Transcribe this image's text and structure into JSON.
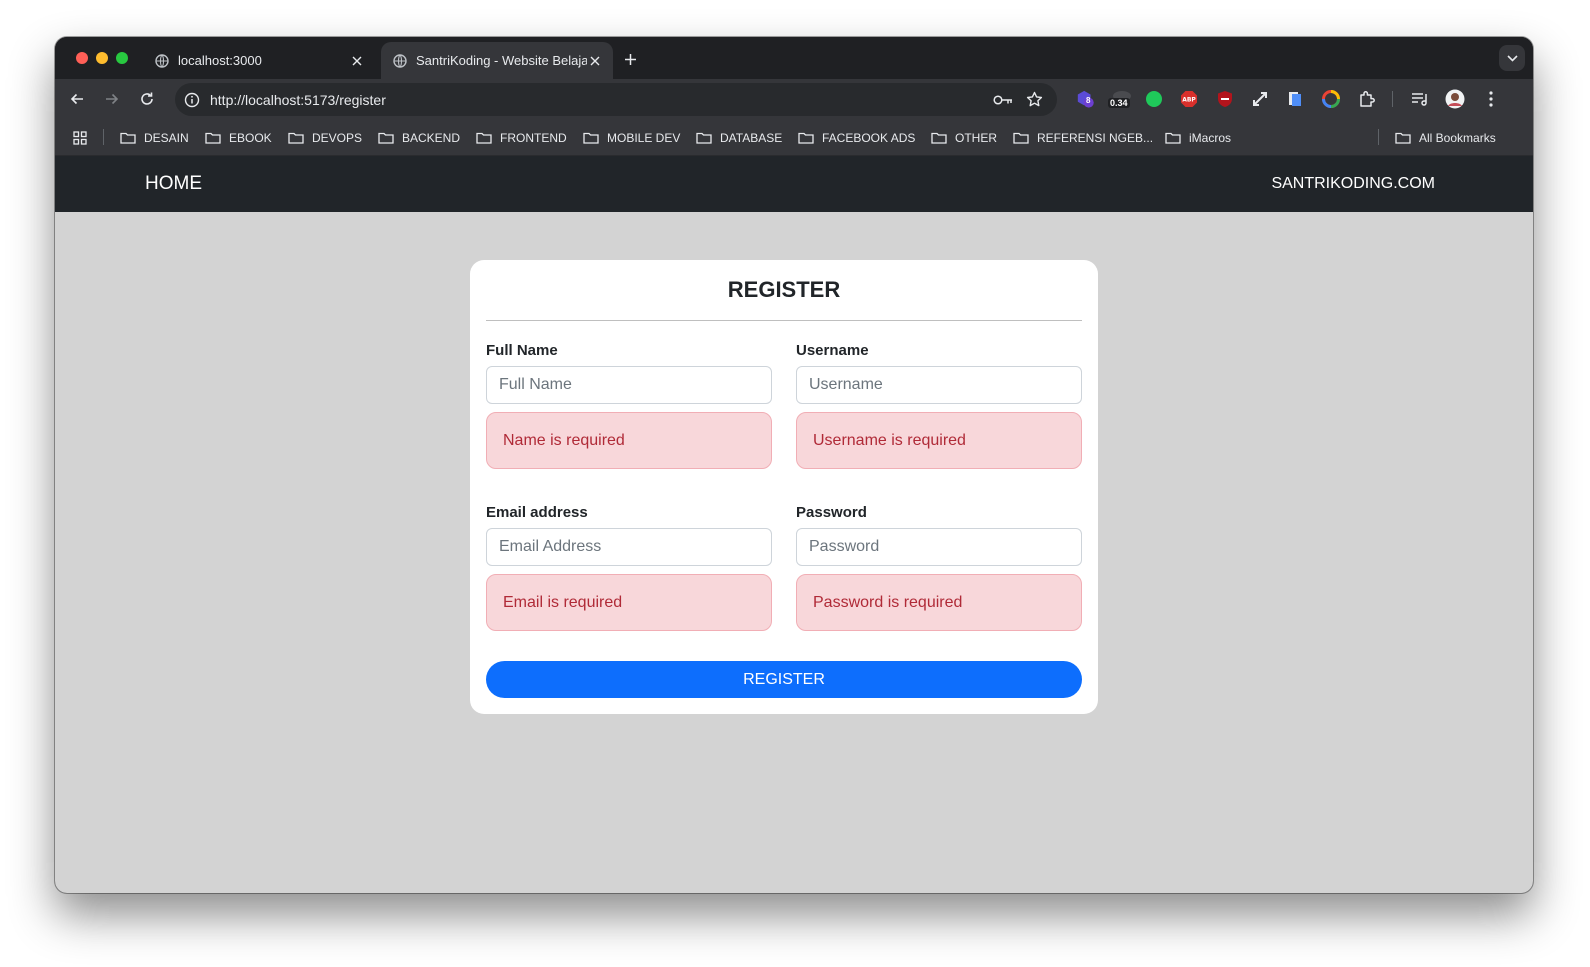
{
  "browser": {
    "tabs": [
      {
        "title": "localhost:3000",
        "active": false
      },
      {
        "title": "SantriKoding - Website Belaja",
        "active": true
      }
    ],
    "url": "http://localhost:5173/register",
    "extensions": {
      "badge_count": "8",
      "badge_value": "0.34"
    },
    "bookmarks": [
      "DESAIN",
      "EBOOK",
      "DEVOPS",
      "BACKEND",
      "FRONTEND",
      "MOBILE DEV",
      "DATABASE",
      "FACEBOOK ADS",
      "OTHER",
      "REFERENSI NGEB...",
      "iMacros"
    ],
    "all_bookmarks": "All Bookmarks"
  },
  "navbar": {
    "home": "HOME",
    "brand": "SANTRIKODING.COM"
  },
  "form": {
    "title": "REGISTER",
    "fields": [
      {
        "label": "Full Name",
        "placeholder": "Full Name",
        "value": "",
        "error": "Name is required"
      },
      {
        "label": "Username",
        "placeholder": "Username",
        "value": "",
        "error": "Username is required"
      },
      {
        "label": "Email address",
        "placeholder": "Email Address",
        "value": "",
        "error": "Email is required"
      },
      {
        "label": "Password",
        "placeholder": "Password",
        "value": "",
        "error": "Password is required"
      }
    ],
    "submit": "REGISTER"
  },
  "colors": {
    "navbar_bg": "#212529",
    "page_bg": "#d3d3d3",
    "primary": "#0d6efd",
    "alert_bg": "#f8d7da",
    "alert_text": "#b02a37"
  }
}
